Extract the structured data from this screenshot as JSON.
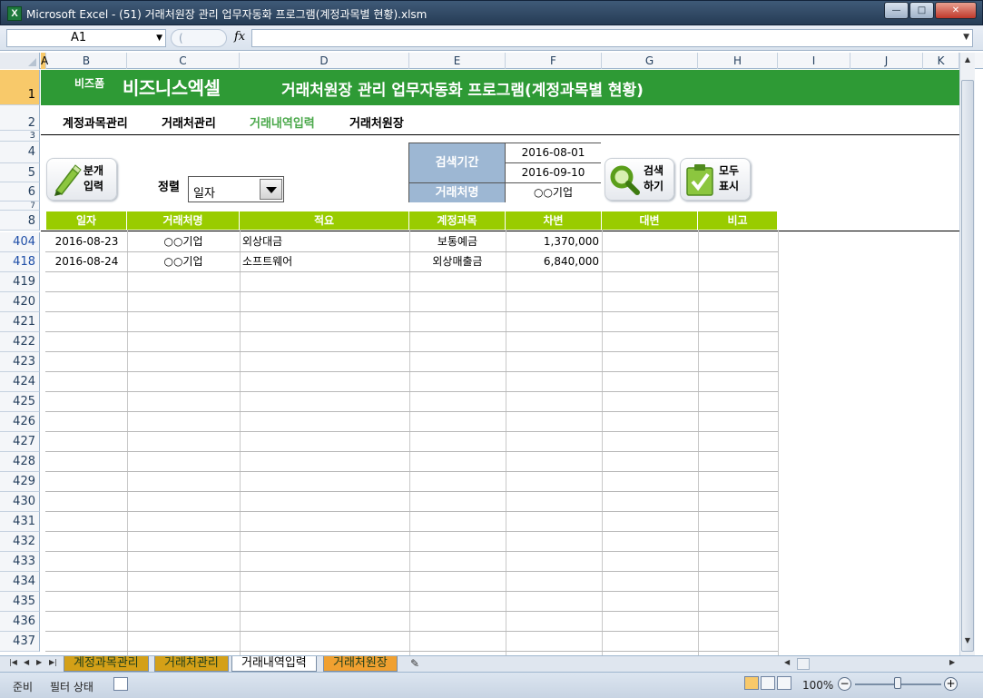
{
  "window": {
    "app_icon": "X",
    "title": "Microsoft Excel - (51) 거래처원장 관리 업무자동화 프로그램(계정과목별 현황).xlsm",
    "min_glyph": "—",
    "max_glyph": "□",
    "close_glyph": "✕"
  },
  "formula_bar": {
    "name_box": "A1",
    "fx_label": "fx",
    "formula": ""
  },
  "columns": [
    "A",
    "B",
    "C",
    "D",
    "E",
    "F",
    "G",
    "H",
    "I",
    "J",
    "K"
  ],
  "top_rows": [
    "1",
    "2",
    "3",
    "4",
    "5",
    "6",
    "7",
    "8"
  ],
  "data_row_numbers": [
    "404",
    "418",
    "419",
    "420",
    "421",
    "422",
    "423",
    "424",
    "425",
    "426",
    "427",
    "428",
    "429",
    "430",
    "431",
    "432",
    "433",
    "434",
    "435",
    "436",
    "437"
  ],
  "banner": {
    "brand_small": "비즈폼",
    "brand": "비즈니스엑셀",
    "title": "거래처원장 관리 업무자동화 프로그램(계정과목별 현황)"
  },
  "nav": {
    "items": [
      "계정과목관리",
      "거래처관리",
      "거래내역입력",
      "거래처원장"
    ],
    "active": "거래내역입력"
  },
  "buttons": {
    "split_entry": [
      "분개",
      "입력"
    ],
    "search": [
      "검색",
      "하기"
    ],
    "show_all": [
      "모두",
      "표시"
    ]
  },
  "sort": {
    "label": "정렬",
    "value": "일자"
  },
  "search_panel": {
    "period_label": "검색기간",
    "start_date": "2016-08-01",
    "end_date": "2016-09-10",
    "client_label": "거래처명",
    "client_value": "○○기업"
  },
  "table": {
    "headers": [
      "일자",
      "거래처명",
      "적요",
      "계정과목",
      "차변",
      "대변",
      "비고"
    ],
    "rows": [
      [
        "2016-08-23",
        "○○기업",
        "외상대금",
        "보통예금",
        "1,370,000",
        "",
        ""
      ],
      [
        "2016-08-24",
        "○○기업",
        "소프트웨어",
        "외상매출금",
        "6,840,000",
        "",
        ""
      ]
    ]
  },
  "sheet_tabs": {
    "tabs": [
      "계정과목관리",
      "거래처관리",
      "거래내역입력",
      "거래처원장"
    ],
    "active": "거래내역입력"
  },
  "status_bar": {
    "ready": "준비",
    "filter_mode": "필터 상태",
    "zoom": "100%",
    "zoom_minus": "−",
    "zoom_plus": "+"
  },
  "colors": {
    "banner_green": "#2e9a35",
    "table_header_green": "#99cc00",
    "search_label_blue": "#9db7d3",
    "nav_active": "#4aa84a",
    "tab_yellow": "#d4a017",
    "tab_orange": "#f0a030"
  },
  "icons": {
    "split_entry": "pencil-icon",
    "search": "magnifier-icon",
    "show_all": "clipboard-check-icon"
  }
}
